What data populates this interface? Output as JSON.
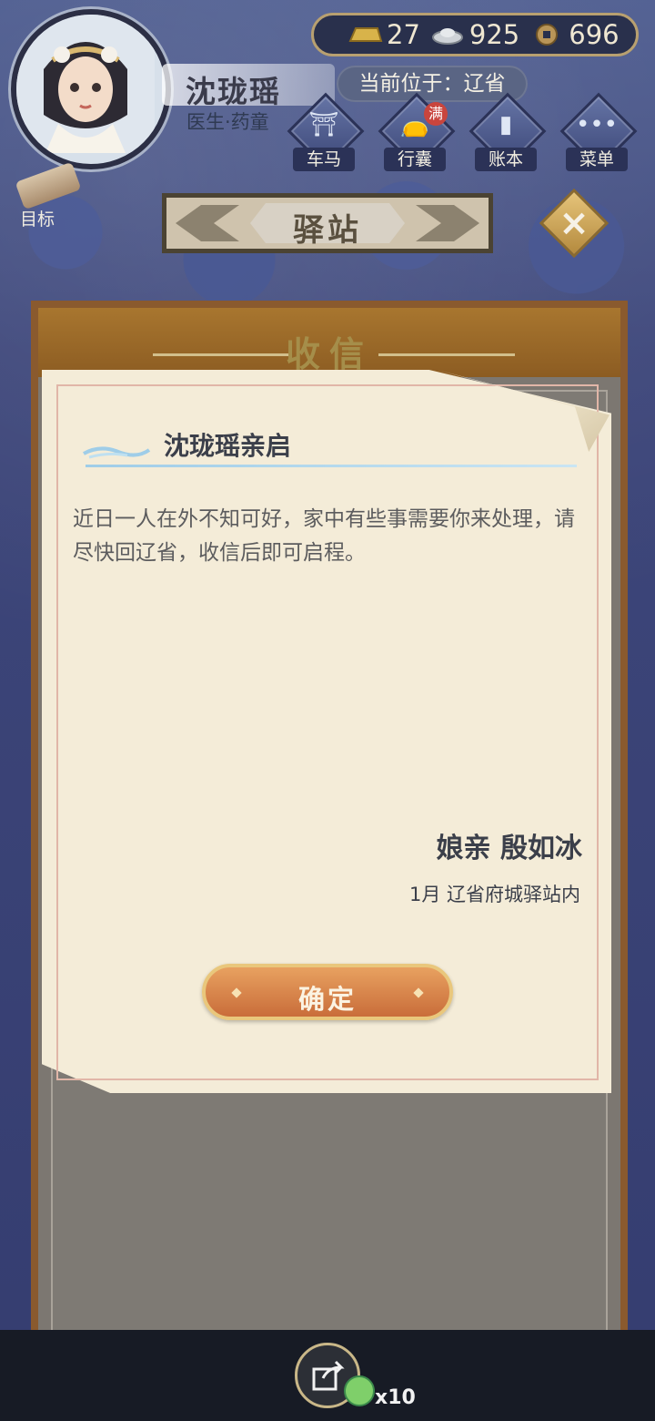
{
  "player": {
    "name": "沈珑瑶",
    "role": "医生·药童"
  },
  "currency": {
    "gold": "27",
    "silver": "925",
    "copper": "696"
  },
  "location": "当前位于：辽省",
  "nav": {
    "items": [
      {
        "label": "车马",
        "icon": "carriage-icon"
      },
      {
        "label": "行囊",
        "icon": "bag-icon",
        "badge": "满"
      },
      {
        "label": "账本",
        "icon": "ledger-icon"
      },
      {
        "label": "菜单",
        "icon": "menu-dots-icon"
      }
    ]
  },
  "goal": {
    "label": "目标"
  },
  "screen": {
    "title": "驿站"
  },
  "panel": {
    "title": "收信"
  },
  "letter": {
    "recipient": "沈珑瑶亲启",
    "body": "近日一人在外不知可好，家中有些事需要你来处理，请尽快回辽省，收信后即可启程。",
    "sender": "娘亲 殷如冰",
    "date_place": "1月 辽省府城驿站内",
    "confirm_label": "确定"
  },
  "bottom": {
    "reward_count": "x10"
  },
  "colors": {
    "background": "#3f4a7c",
    "paper": "#f4ecd8",
    "button": "#d9864a",
    "panel_border": "#8a5a2e"
  }
}
